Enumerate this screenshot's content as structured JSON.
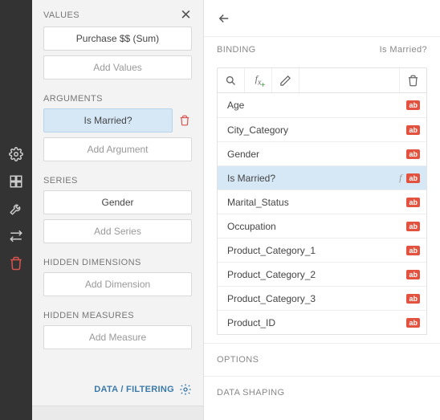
{
  "iconbar": {
    "items": [
      "gear",
      "layout",
      "wrench",
      "swap",
      "trash"
    ]
  },
  "left": {
    "sections": {
      "values": {
        "title": "VALUES",
        "item": "Purchase $$ (Sum)",
        "add_label": "Add Values"
      },
      "arguments": {
        "title": "ARGUMENTS",
        "item": "Is Married?",
        "add_label": "Add Argument"
      },
      "series": {
        "title": "SERIES",
        "item": "Gender",
        "add_label": "Add Series"
      },
      "hidden_dim": {
        "title": "HIDDEN DIMENSIONS",
        "add_label": "Add Dimension"
      },
      "hidden_meas": {
        "title": "HIDDEN MEASURES",
        "add_label": "Add Measure"
      }
    },
    "footer_label": "DATA / FILTERING"
  },
  "right": {
    "binding_title": "BINDING",
    "binding_current": "Is Married?",
    "tag": "ab",
    "fields": [
      {
        "name": "Age",
        "selected": false,
        "calc": false
      },
      {
        "name": "City_Category",
        "selected": false,
        "calc": false
      },
      {
        "name": "Gender",
        "selected": false,
        "calc": false
      },
      {
        "name": "Is Married?",
        "selected": true,
        "calc": true
      },
      {
        "name": "Marital_Status",
        "selected": false,
        "calc": false
      },
      {
        "name": "Occupation",
        "selected": false,
        "calc": false
      },
      {
        "name": "Product_Category_1",
        "selected": false,
        "calc": false
      },
      {
        "name": "Product_Category_2",
        "selected": false,
        "calc": false
      },
      {
        "name": "Product_Category_3",
        "selected": false,
        "calc": false
      },
      {
        "name": "Product_ID",
        "selected": false,
        "calc": false
      }
    ],
    "options_title": "OPTIONS",
    "shaping_title": "DATA SHAPING"
  }
}
